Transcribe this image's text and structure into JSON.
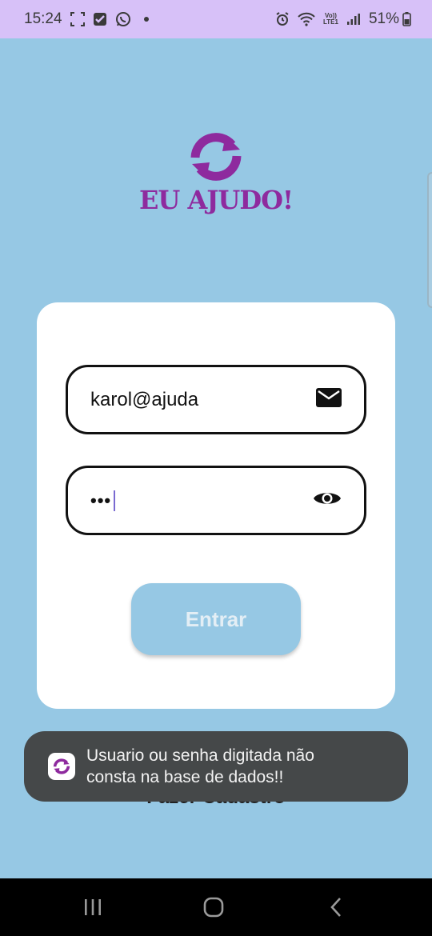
{
  "status_bar": {
    "time": "15:24",
    "battery": "51%",
    "network_label": "Vo))\nLTE1",
    "icons": [
      "screenshot-icon",
      "checkbox-icon",
      "whatsapp-icon",
      "dot-icon",
      "alarm-icon",
      "wifi-icon",
      "volte-icon",
      "signal-icon",
      "battery-icon"
    ]
  },
  "logo": {
    "text": "EU AJUDO!",
    "color": "#8E2A9E"
  },
  "login": {
    "email_value": "karol@ajuda",
    "email_icon": "mail-icon",
    "password_dots": "•••",
    "password_icon": "eye-icon",
    "submit_label": "Entrar"
  },
  "register_link": "Fazer Cadastro",
  "toast": {
    "line1": "Usuario ou senha digitada não",
    "line2": "consta na base de dados!!"
  },
  "nav_bar": {
    "buttons": [
      "recents-icon",
      "home-icon",
      "back-icon"
    ]
  },
  "colors": {
    "background": "#96C8E4",
    "status_bar": "#D7C1F8",
    "card": "#FFFFFF",
    "button": "#96C8E4",
    "toast": "#454849"
  }
}
